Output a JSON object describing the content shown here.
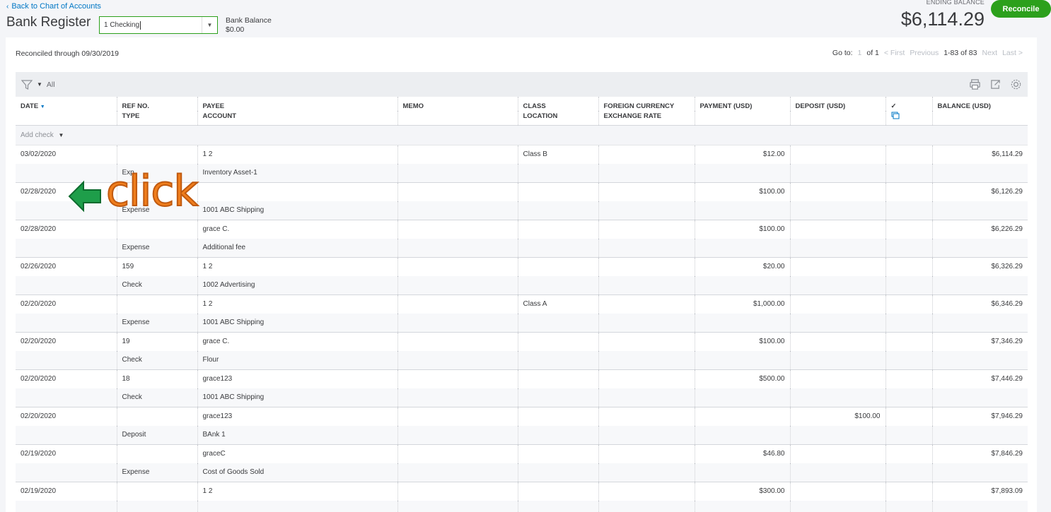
{
  "header": {
    "back_link": "Back to Chart of Accounts",
    "title": "Bank Register",
    "account_select": "1 Checking",
    "bank_balance_label": "Bank Balance",
    "bank_balance_value": "$0.00",
    "ending_balance_label": "ENDING BALANCE",
    "ending_balance_value": "$6,114.29",
    "reconcile_button": "Reconcile"
  },
  "toolbar": {
    "reconciled_through": "Reconciled through 09/30/2019",
    "filter_all": "All",
    "pager": {
      "goto_label": "Go to:",
      "page_input": "1",
      "of_pages": "of 1",
      "first": "< First",
      "previous": "Previous",
      "range": "1-83 of 83",
      "next": "Next",
      "last": "Last >"
    }
  },
  "columns": {
    "date": "DATE",
    "ref_no": "REF NO.",
    "type": "TYPE",
    "payee": "PAYEE",
    "account": "ACCOUNT",
    "memo": "MEMO",
    "class": "CLASS",
    "location": "LOCATION",
    "foreign_currency": "FOREIGN CURRENCY",
    "exchange_rate": "EXCHANGE RATE",
    "payment": "PAYMENT (USD)",
    "deposit": "DEPOSIT (USD)",
    "reconcile_mark": "✓",
    "balance": "BALANCE (USD)"
  },
  "add_check": "Add check",
  "rows": [
    {
      "date": "03/02/2020",
      "ref": "",
      "type": "Exp",
      "payee": "1 2",
      "account": "Inventory Asset-1",
      "class": "Class B",
      "payment": "$12.00",
      "deposit": "",
      "balance": "$6,114.29"
    },
    {
      "date": "02/28/2020",
      "ref": "",
      "type": "Expense",
      "payee": "",
      "account": "1001 ABC Shipping",
      "class": "",
      "payment": "$100.00",
      "deposit": "",
      "balance": "$6,126.29"
    },
    {
      "date": "02/28/2020",
      "ref": "",
      "type": "Expense",
      "payee": "grace C.",
      "account": "Additional fee",
      "class": "",
      "payment": "$100.00",
      "deposit": "",
      "balance": "$6,226.29"
    },
    {
      "date": "02/26/2020",
      "ref": "159",
      "type": "Check",
      "payee": "1 2",
      "account": "1002 Advertising",
      "class": "",
      "payment": "$20.00",
      "deposit": "",
      "balance": "$6,326.29"
    },
    {
      "date": "02/20/2020",
      "ref": "",
      "type": "Expense",
      "payee": "1 2",
      "account": "1001 ABC Shipping",
      "class": "Class A",
      "payment": "$1,000.00",
      "deposit": "",
      "balance": "$6,346.29"
    },
    {
      "date": "02/20/2020",
      "ref": "19",
      "type": "Check",
      "payee": "grace C.",
      "account": "Flour",
      "class": "",
      "payment": "$100.00",
      "deposit": "",
      "balance": "$7,346.29"
    },
    {
      "date": "02/20/2020",
      "ref": "18",
      "type": "Check",
      "payee": "grace123",
      "account": "1001 ABC Shipping",
      "class": "",
      "payment": "$500.00",
      "deposit": "",
      "balance": "$7,446.29"
    },
    {
      "date": "02/20/2020",
      "ref": "",
      "type": "Deposit",
      "payee": "grace123",
      "account": "BAnk 1",
      "class": "",
      "payment": "",
      "deposit": "$100.00",
      "balance": "$7,946.29"
    },
    {
      "date": "02/19/2020",
      "ref": "",
      "type": "Expense",
      "payee": "graceC",
      "account": "Cost of Goods Sold",
      "class": "",
      "payment": "$46.80",
      "deposit": "",
      "balance": "$7,846.29"
    },
    {
      "date": "02/19/2020",
      "ref": "",
      "type": "",
      "payee": "1 2",
      "account": "",
      "class": "",
      "payment": "$300.00",
      "deposit": "",
      "balance": "$7,893.09"
    }
  ],
  "annotation": {
    "text": "click",
    "arrow_color": "#1e9e4a",
    "text_color": "#f07e1c"
  },
  "colors": {
    "accent_green": "#2ca01c",
    "link_blue": "#0077c5"
  }
}
